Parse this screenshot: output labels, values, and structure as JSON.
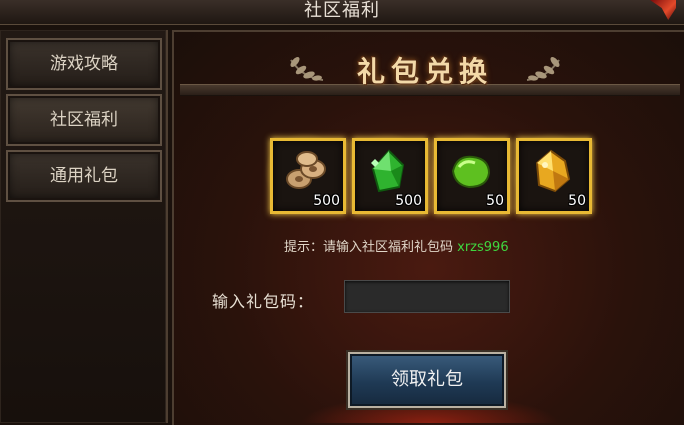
{
  "window": {
    "title": "社区福利"
  },
  "sidebar": {
    "items": [
      {
        "label": "游戏攻略"
      },
      {
        "label": "社区福利"
      },
      {
        "label": "通用礼包"
      }
    ]
  },
  "main": {
    "banner_title": "礼包兑换",
    "rewards": [
      {
        "icon": "copper-coins-icon",
        "count": "500"
      },
      {
        "icon": "green-crystal-icon",
        "count": "500"
      },
      {
        "icon": "green-gem-icon",
        "count": "50"
      },
      {
        "icon": "golden-ore-icon",
        "count": "50"
      }
    ],
    "hint_prefix": "提示：请输入社区福利礼包码 ",
    "hint_code": "xrzs996",
    "input_label": "输入礼包码：",
    "input_value": "",
    "claim_button": "领取礼包"
  },
  "colors": {
    "accent_gold": "#e8b934",
    "hint_green": "#3fd63f",
    "button_blue": "#1f3a55"
  }
}
